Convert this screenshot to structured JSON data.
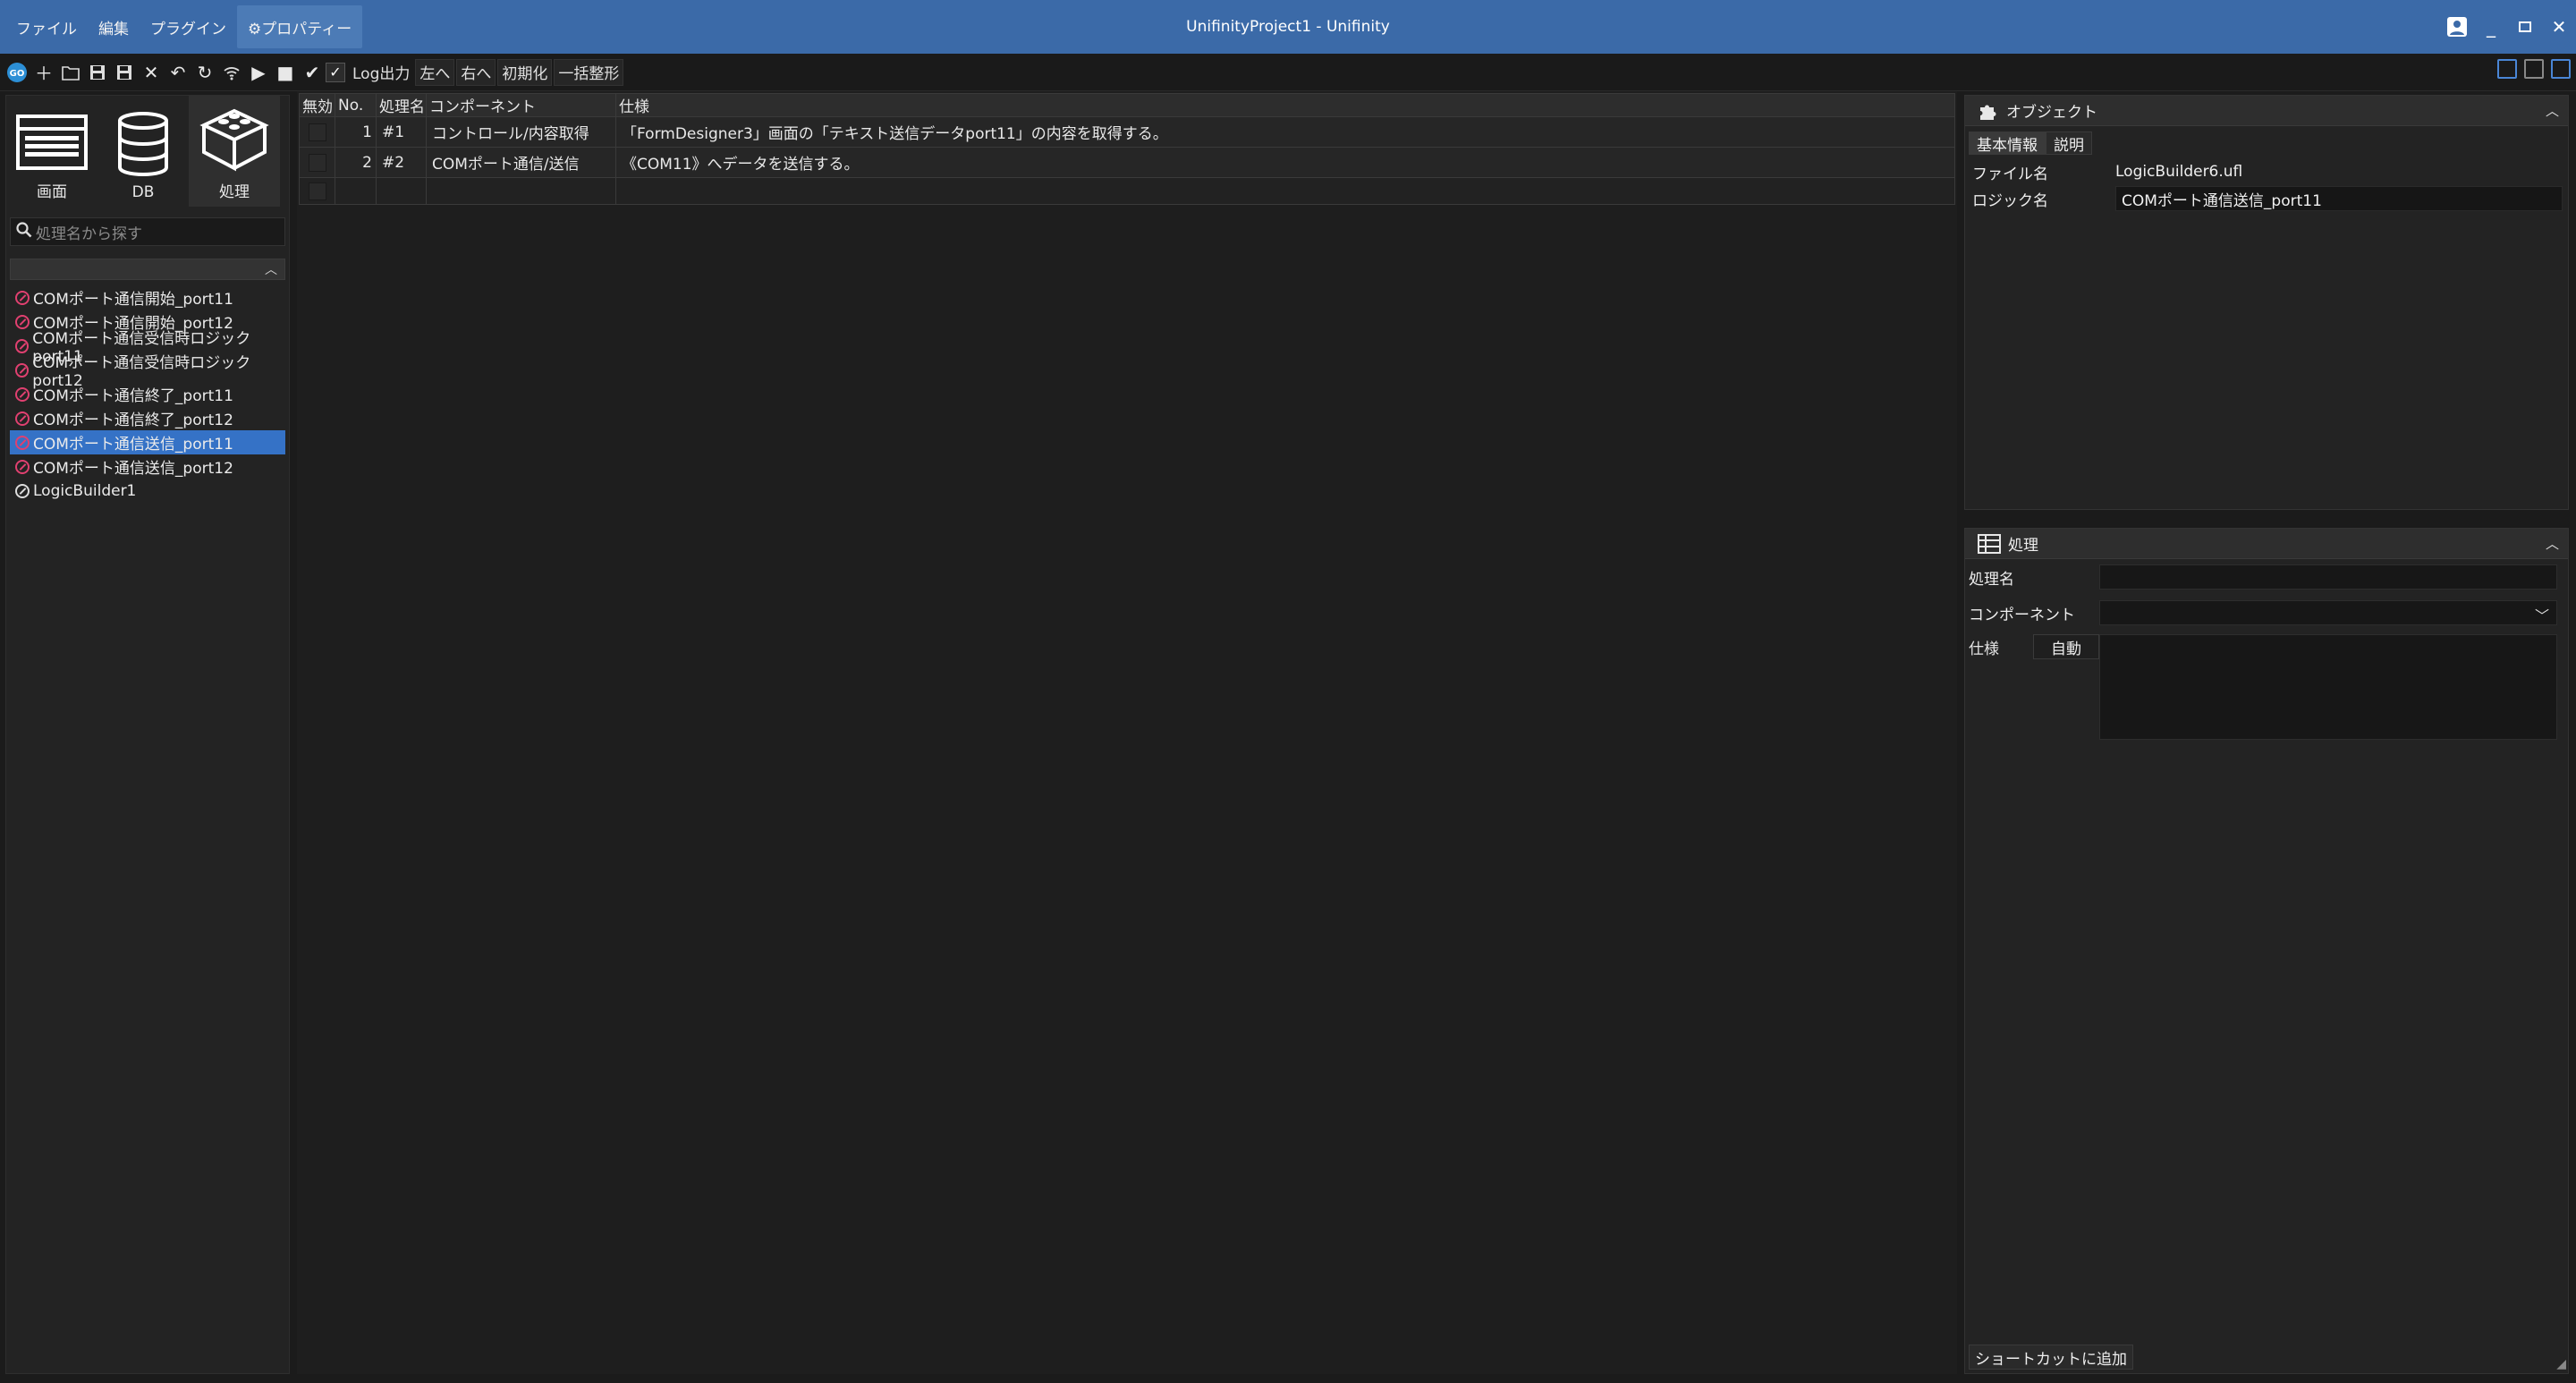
{
  "window": {
    "title": "UnifinityProject1 - Unifinity"
  },
  "menu": {
    "items": [
      "ファイル",
      "編集",
      "プラグイン"
    ],
    "properties_label": "⚙プロパティー"
  },
  "toolbar": {
    "log_label": "Log出力",
    "left_label": "左へ",
    "right_label": "右へ",
    "init_label": "初期化",
    "format_label": "一括整形",
    "icons": [
      "go-icon",
      "add-icon",
      "open-folder-icon",
      "save-icon",
      "save-all-icon",
      "close-icon",
      "undo-icon",
      "refresh-icon",
      "wifi-icon",
      "play-icon",
      "stop-icon",
      "check-icon"
    ]
  },
  "sidebar": {
    "categories": [
      {
        "label": "画面",
        "icon": "screen-icon"
      },
      {
        "label": "DB",
        "icon": "database-icon"
      },
      {
        "label": "処理",
        "icon": "blocks-icon"
      }
    ],
    "search_placeholder": "処理名から探す",
    "items": [
      {
        "label": "COMポート通信開始_port11",
        "selected": false
      },
      {
        "label": "COMポート通信開始_port12",
        "selected": false
      },
      {
        "label": "COMポート通信受信時ロジックport11",
        "selected": false
      },
      {
        "label": "COMポート通信受信時ロジックport12",
        "selected": false
      },
      {
        "label": "COMポート通信終了_port11",
        "selected": false
      },
      {
        "label": "COMポート通信終了_port12",
        "selected": false
      },
      {
        "label": "COMポート通信送信_port11",
        "selected": true
      },
      {
        "label": "COMポート通信送信_port12",
        "selected": false
      },
      {
        "label": "LogicBuilder1",
        "selected": false
      }
    ]
  },
  "grid": {
    "headers": [
      "無効",
      "No.",
      "処理名",
      "コンポーネント",
      "仕様"
    ],
    "rows": [
      {
        "no": "1",
        "name": "#1",
        "component": "コントロール/内容取得",
        "spec": "「FormDesigner3」画面の「テキスト送信データport11」の内容を取得する。"
      },
      {
        "no": "2",
        "name": "#2",
        "component": "COMポート通信/送信",
        "spec": "《COM11》へデータを送信する。"
      }
    ]
  },
  "object_panel": {
    "title": "オブジェクト",
    "tabs": [
      "基本情報",
      "説明"
    ],
    "file_name_label": "ファイル名",
    "file_name_value": "LogicBuilder6.ufl",
    "logic_name_label": "ロジック名",
    "logic_name_value": "COMポート通信送信_port11"
  },
  "process_panel": {
    "title": "処理",
    "name_label": "処理名",
    "component_label": "コンポーネント",
    "spec_label": "仕様",
    "auto_label": "自動",
    "shortcut_label": "ショートカットに追加"
  }
}
